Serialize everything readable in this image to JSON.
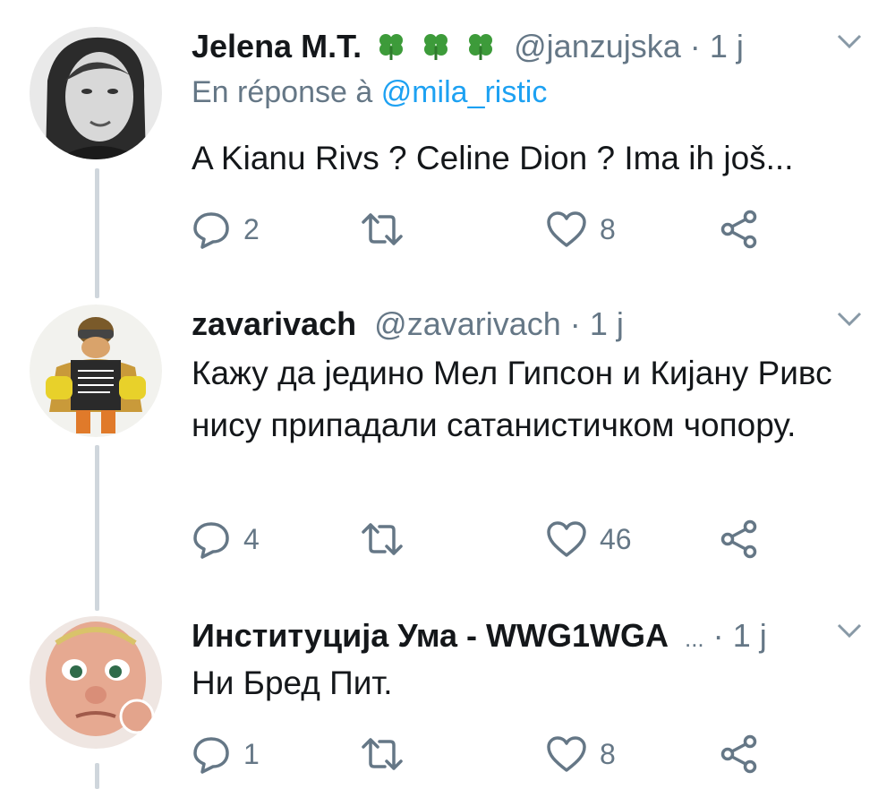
{
  "tweets": [
    {
      "name": "Jelena M.T.",
      "clovers": [
        "four-leaf-clover-icon",
        "four-leaf-clover-icon",
        "four-leaf-clover-icon"
      ],
      "handle": "@janzujska",
      "separator": "·",
      "time": "1 j",
      "reply_prefix": "En réponse à",
      "reply_handle": "@mila_ristic",
      "text": "A Kianu Rivs ? Celine Dion ? Ima ih još...",
      "replies": "2",
      "retweets": "",
      "likes": "8"
    },
    {
      "name": "zavarivach",
      "handle": "@zavarivach",
      "separator": "·",
      "time": "1 j",
      "text": "Кажу да једино Мел Гипсон и Кијану Ривс нису припадали сатанистичком чопору.",
      "replies": "4",
      "retweets": "",
      "likes": "46"
    },
    {
      "name": "Институција Ума - WWG1WGA",
      "ellipsis": "...",
      "separator": "·",
      "time": "1 j",
      "text": "Ни Бред Пит.",
      "replies": "1",
      "retweets": "",
      "likes": "8"
    }
  ],
  "colors": {
    "text": "#14171a",
    "muted": "#657786",
    "link": "#1da1f2",
    "thread_line": "#cfd6dc",
    "clover": "#3d9b3a"
  }
}
